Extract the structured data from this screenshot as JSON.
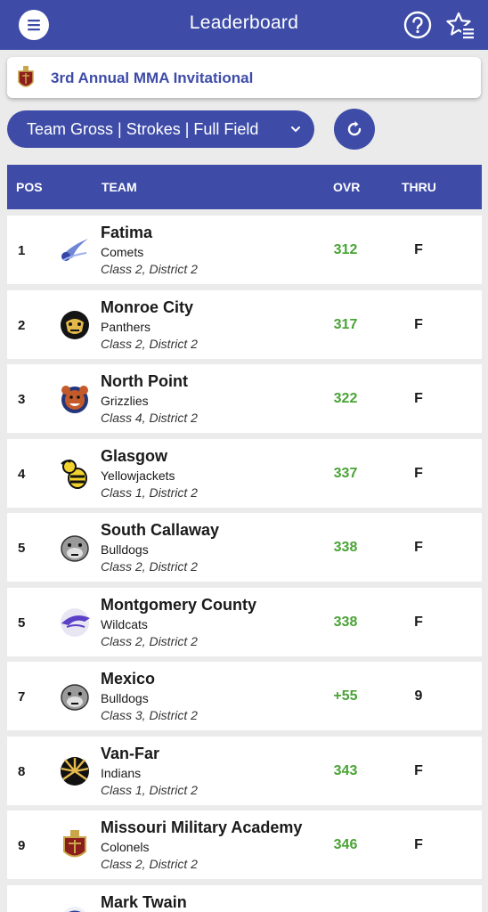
{
  "header": {
    "title": "Leaderboard"
  },
  "event": {
    "name": "3rd Annual MMA Invitational"
  },
  "filter": {
    "selected": "Team Gross | Strokes | Full Field"
  },
  "table": {
    "columns": {
      "pos": "POS",
      "team": "TEAM",
      "ovr": "OVR",
      "thru": "THRU"
    },
    "rows": [
      {
        "pos": "1",
        "name": "Fatima",
        "mascot": "Comets",
        "division": "Class 2, District 2",
        "ovr": "312",
        "thru": "F",
        "logo": "comet-logo"
      },
      {
        "pos": "2",
        "name": "Monroe City",
        "mascot": "Panthers",
        "division": "Class 2, District 2",
        "ovr": "317",
        "thru": "F",
        "logo": "panther-logo"
      },
      {
        "pos": "3",
        "name": "North Point",
        "mascot": "Grizzlies",
        "division": "Class 4, District 2",
        "ovr": "322",
        "thru": "F",
        "logo": "grizzly-logo"
      },
      {
        "pos": "4",
        "name": "Glasgow",
        "mascot": "Yellowjackets",
        "division": "Class 1, District 2",
        "ovr": "337",
        "thru": "F",
        "logo": "yellowjacket-logo"
      },
      {
        "pos": "5",
        "name": "South Callaway",
        "mascot": "Bulldogs",
        "division": "Class 2, District 2",
        "ovr": "338",
        "thru": "F",
        "logo": "bulldog-logo"
      },
      {
        "pos": "5",
        "name": "Montgomery County",
        "mascot": "Wildcats",
        "division": "Class 2, District 2",
        "ovr": "338",
        "thru": "F",
        "logo": "wildcat-logo"
      },
      {
        "pos": "7",
        "name": "Mexico",
        "mascot": "Bulldogs",
        "division": "Class 3, District 2",
        "ovr": "+55",
        "thru": "9",
        "logo": "bulldog-logo"
      },
      {
        "pos": "8",
        "name": "Van-Far",
        "mascot": "Indians",
        "division": "Class 1, District 2",
        "ovr": "343",
        "thru": "F",
        "logo": "indian-logo"
      },
      {
        "pos": "9",
        "name": "Missouri Military Academy",
        "mascot": "Colonels",
        "division": "Class 2, District 2",
        "ovr": "346",
        "thru": "F",
        "logo": "colonel-crest-logo"
      },
      {
        "pos": "",
        "name": "Mark Twain",
        "mascot": "",
        "division": "",
        "ovr": "",
        "thru": "",
        "logo": "tiger-logo"
      }
    ]
  },
  "colors": {
    "primary": "#3e4ca8",
    "score_green": "#4aa336",
    "background": "#ebebeb"
  }
}
